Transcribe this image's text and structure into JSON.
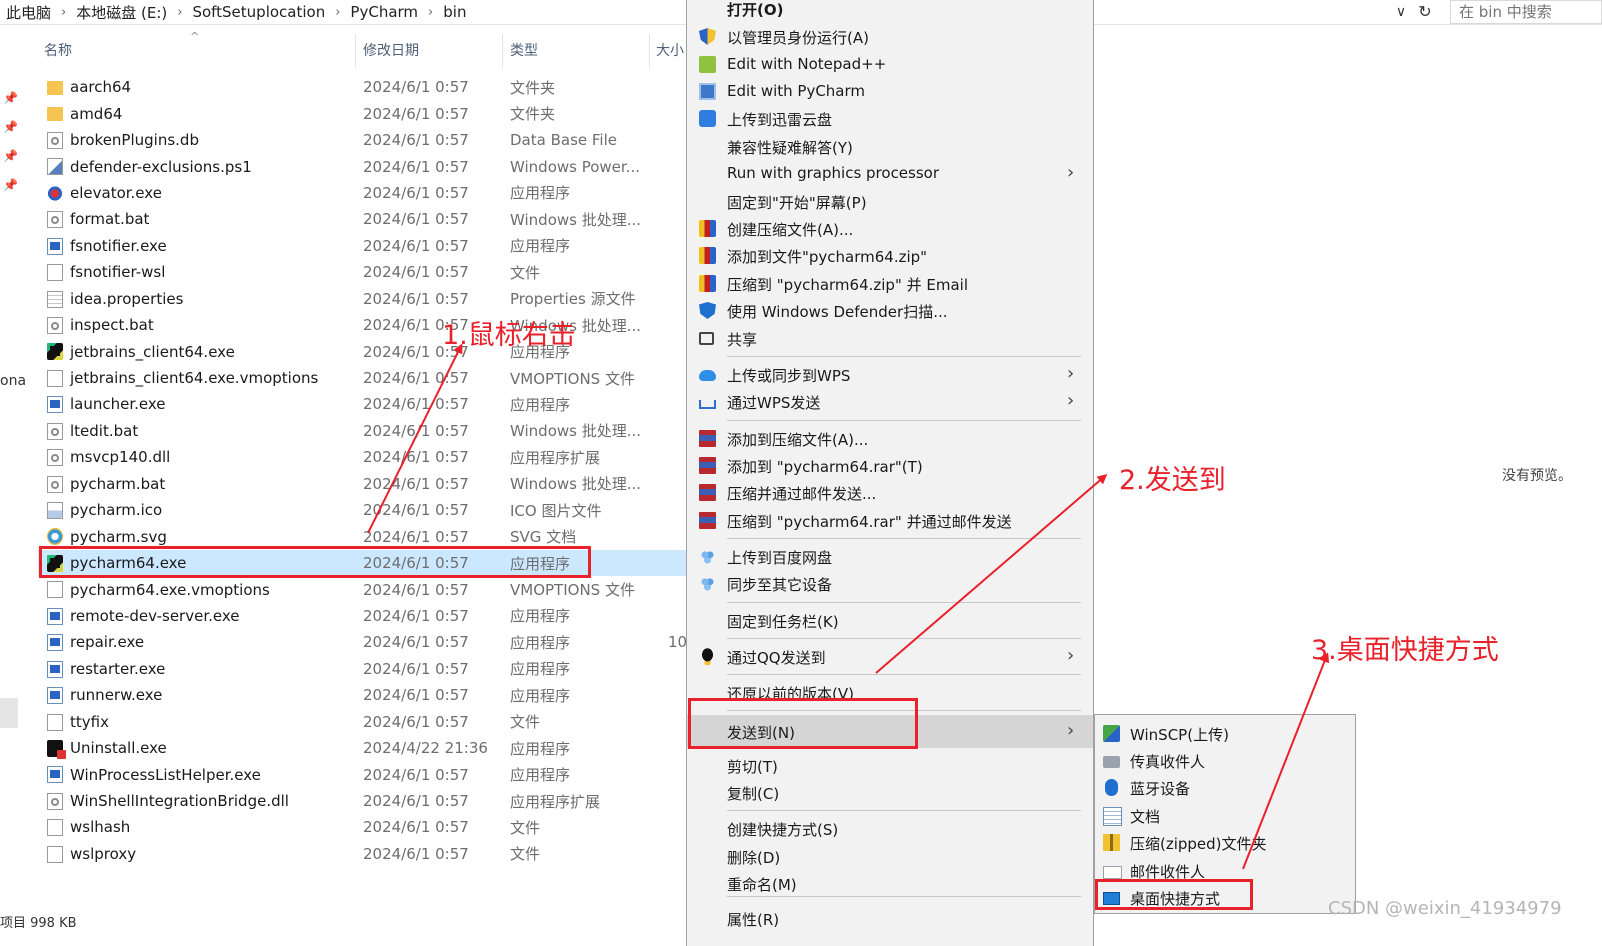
{
  "address_bar": {
    "crumbs": [
      "此电脑",
      "本地磁盘 (E:)",
      "SoftSetuplocation",
      "PyCharm",
      "bin"
    ],
    "separator": "›",
    "dropdown_glyph": "∨",
    "refresh_glyph": "↻",
    "search_placeholder": "在 bin 中搜索"
  },
  "nav": {
    "truncated_text": "ona"
  },
  "columns": {
    "name": "名称",
    "date": "修改日期",
    "type": "类型",
    "size": "大小"
  },
  "files": [
    {
      "name": "aarch64",
      "date": "2024/6/1 0:57",
      "type": "文件夹",
      "icon": "folder-icon"
    },
    {
      "name": "amd64",
      "date": "2024/6/1 0:57",
      "type": "文件夹",
      "icon": "folder-icon"
    },
    {
      "name": "brokenPlugins.db",
      "date": "2024/6/1 0:57",
      "type": "Data Base File",
      "icon": "gear-file-icon"
    },
    {
      "name": "defender-exclusions.ps1",
      "date": "2024/6/1 0:57",
      "type": "Windows Power...",
      "icon": "powershell-file-icon"
    },
    {
      "name": "elevator.exe",
      "date": "2024/6/1 0:57",
      "type": "应用程序",
      "icon": "elevator-icon"
    },
    {
      "name": "format.bat",
      "date": "2024/6/1 0:57",
      "type": "Windows 批处理...",
      "icon": "gear-file-icon"
    },
    {
      "name": "fsnotifier.exe",
      "date": "2024/6/1 0:57",
      "type": "应用程序",
      "icon": "exe-icon"
    },
    {
      "name": "fsnotifier-wsl",
      "date": "2024/6/1 0:57",
      "type": "文件",
      "icon": "file-icon"
    },
    {
      "name": "idea.properties",
      "date": "2024/6/1 0:57",
      "type": "Properties 源文件",
      "icon": "document-icon"
    },
    {
      "name": "inspect.bat",
      "date": "2024/6/1 0:57",
      "type": "Windows 批处理...",
      "icon": "gear-file-icon"
    },
    {
      "name": "jetbrains_client64.exe",
      "date": "2024/6/1 0:57",
      "type": "应用程序",
      "icon": "pycharm-icon"
    },
    {
      "name": "jetbrains_client64.exe.vmoptions",
      "date": "2024/6/1 0:57",
      "type": "VMOPTIONS 文件",
      "icon": "file-icon"
    },
    {
      "name": "launcher.exe",
      "date": "2024/6/1 0:57",
      "type": "应用程序",
      "icon": "exe-icon"
    },
    {
      "name": "ltedit.bat",
      "date": "2024/6/1 0:57",
      "type": "Windows 批处理...",
      "icon": "gear-file-icon"
    },
    {
      "name": "msvcp140.dll",
      "date": "2024/6/1 0:57",
      "type": "应用程序扩展",
      "icon": "gear-file-icon"
    },
    {
      "name": "pycharm.bat",
      "date": "2024/6/1 0:57",
      "type": "Windows 批处理...",
      "icon": "gear-file-icon"
    },
    {
      "name": "pycharm.ico",
      "date": "2024/6/1 0:57",
      "type": "ICO 图片文件",
      "icon": "image-file-icon"
    },
    {
      "name": "pycharm.svg",
      "date": "2024/6/1 0:57",
      "type": "SVG 文档",
      "icon": "svg-file-icon"
    },
    {
      "name": "pycharm64.exe",
      "date": "2024/6/1 0:57",
      "type": "应用程序",
      "icon": "pycharm-icon",
      "selected": true
    },
    {
      "name": "pycharm64.exe.vmoptions",
      "date": "2024/6/1 0:57",
      "type": "VMOPTIONS 文件",
      "icon": "file-icon"
    },
    {
      "name": "remote-dev-server.exe",
      "date": "2024/6/1 0:57",
      "type": "应用程序",
      "icon": "exe-icon"
    },
    {
      "name": "repair.exe",
      "date": "2024/6/1 0:57",
      "type": "应用程序",
      "icon": "exe-icon",
      "size": "10"
    },
    {
      "name": "restarter.exe",
      "date": "2024/6/1 0:57",
      "type": "应用程序",
      "icon": "exe-icon"
    },
    {
      "name": "runnerw.exe",
      "date": "2024/6/1 0:57",
      "type": "应用程序",
      "icon": "exe-icon"
    },
    {
      "name": "ttyfix",
      "date": "2024/6/1 0:57",
      "type": "文件",
      "icon": "file-icon"
    },
    {
      "name": "Uninstall.exe",
      "date": "2024/4/22 21:36",
      "type": "应用程序",
      "icon": "uninstall-icon"
    },
    {
      "name": "WinProcessListHelper.exe",
      "date": "2024/6/1 0:57",
      "type": "应用程序",
      "icon": "exe-icon"
    },
    {
      "name": "WinShellIntegrationBridge.dll",
      "date": "2024/6/1 0:57",
      "type": "应用程序扩展",
      "icon": "gear-file-icon"
    },
    {
      "name": "wslhash",
      "date": "2024/6/1 0:57",
      "type": "文件",
      "icon": "file-icon"
    },
    {
      "name": "wslproxy",
      "date": "2024/6/1 0:57",
      "type": "文件",
      "icon": "file-icon"
    }
  ],
  "status_bar": {
    "text": "项目  998 KB"
  },
  "preview": {
    "text": "没有预览。"
  },
  "context_menu": {
    "items": [
      {
        "label": "打开(O)",
        "icon": "",
        "bold": true
      },
      {
        "label": "以管理员身份运行(A)",
        "icon": "uac-shield-icon"
      },
      {
        "label": "Edit with Notepad++",
        "icon": "notepadpp-icon"
      },
      {
        "label": "Edit with PyCharm",
        "icon": "pycharm-edit-icon"
      },
      {
        "label": "上传到迅雷云盘",
        "icon": "xunlei-icon"
      },
      {
        "label": "兼容性疑难解答(Y)",
        "icon": ""
      },
      {
        "label": "Run with graphics processor",
        "icon": "",
        "submenu": true
      },
      {
        "label": "固定到\"开始\"屏幕(P)",
        "icon": ""
      },
      {
        "label": "创建压缩文件(A)...",
        "icon": "zip-icon"
      },
      {
        "label": "添加到文件\"pycharm64.zip\"",
        "icon": "zip-icon"
      },
      {
        "label": "压缩到 \"pycharm64.zip\" 并 Email",
        "icon": "zip-icon"
      },
      {
        "label": "使用 Windows Defender扫描...",
        "icon": "defender-icon"
      },
      {
        "label": "共享",
        "icon": "share-icon"
      },
      {
        "label": "上传或同步到WPS",
        "icon": "wps-cloud-icon",
        "submenu": true
      },
      {
        "label": "通过WPS发送",
        "icon": "wps-send-icon",
        "submenu": true
      },
      {
        "label": "添加到压缩文件(A)...",
        "icon": "winrar-icon"
      },
      {
        "label": "添加到 \"pycharm64.rar\"(T)",
        "icon": "winrar-icon"
      },
      {
        "label": "压缩并通过邮件发送...",
        "icon": "winrar-icon"
      },
      {
        "label": "压缩到 \"pycharm64.rar\" 并通过邮件发送",
        "icon": "winrar-icon"
      },
      {
        "label": "上传到百度网盘",
        "icon": "baidu-icon"
      },
      {
        "label": "同步至其它设备",
        "icon": "baidu-icon"
      },
      {
        "label": "固定到任务栏(K)",
        "icon": ""
      },
      {
        "label": "通过QQ发送到",
        "icon": "qq-icon",
        "submenu": true
      },
      {
        "label": "还原以前的版本(V)",
        "icon": ""
      },
      {
        "label": "发送到(N)",
        "icon": "",
        "submenu": true,
        "highlighted": true
      },
      {
        "label": "剪切(T)",
        "icon": ""
      },
      {
        "label": "复制(C)",
        "icon": ""
      },
      {
        "label": "创建快捷方式(S)",
        "icon": ""
      },
      {
        "label": "删除(D)",
        "icon": ""
      },
      {
        "label": "重命名(M)",
        "icon": ""
      },
      {
        "label": "属性(R)",
        "icon": ""
      }
    ],
    "submenu_arrow": "›"
  },
  "sendto_menu": {
    "items": [
      {
        "label": "WinSCP(上传)",
        "icon": "winscp-icon"
      },
      {
        "label": "传真收件人",
        "icon": "fax-icon"
      },
      {
        "label": "蓝牙设备",
        "icon": "bluetooth-icon"
      },
      {
        "label": "文档",
        "icon": "documents-icon"
      },
      {
        "label": "压缩(zipped)文件夹",
        "icon": "zipped-folder-icon"
      },
      {
        "label": "邮件收件人",
        "icon": "mail-icon"
      },
      {
        "label": "桌面快捷方式",
        "icon": "desktop-icon"
      }
    ]
  },
  "annotations": {
    "step1": "1.鼠标右击",
    "step2": "2.发送到",
    "step3": "3.桌面快捷方式",
    "color": "#e8212a"
  },
  "watermark": {
    "text": "CSDN @weixin_41934979"
  }
}
